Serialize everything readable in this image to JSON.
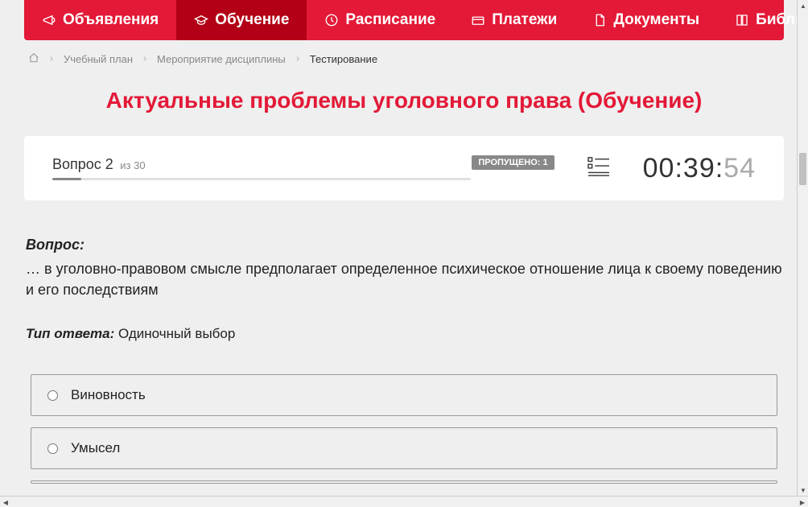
{
  "nav": {
    "items": [
      {
        "icon": "megaphone",
        "label": "Объявления"
      },
      {
        "icon": "graduation",
        "label": "Обучение"
      },
      {
        "icon": "clock",
        "label": "Расписание"
      },
      {
        "icon": "payment",
        "label": "Платежи"
      },
      {
        "icon": "document",
        "label": "Документы"
      },
      {
        "icon": "book",
        "label": "Библиотека",
        "chevron": true
      }
    ],
    "activeIndex": 1
  },
  "breadcrumbs": {
    "items": [
      {
        "label": "Учебный план"
      },
      {
        "label": "Мероприятие дисциплины"
      }
    ],
    "current": "Тестирование"
  },
  "title": "Актуальные проблемы уголовного права (Обучение)",
  "status": {
    "question_label": "Вопрос 2",
    "total_label": "из 30",
    "skipped_label": "ПРОПУЩЕНО: 1",
    "timer_main": "00:39:",
    "timer_sec": "54"
  },
  "question": {
    "heading": "Вопрос:",
    "text": "… в уголовно-правовом смысле предполагает определенное психическое отношение лица к своему поведению и его последствиям",
    "answer_type_label": "Тип ответа:",
    "answer_type_value": " Одиночный выбор"
  },
  "answers": [
    {
      "text": "Виновность"
    },
    {
      "text": "Умысел"
    }
  ]
}
